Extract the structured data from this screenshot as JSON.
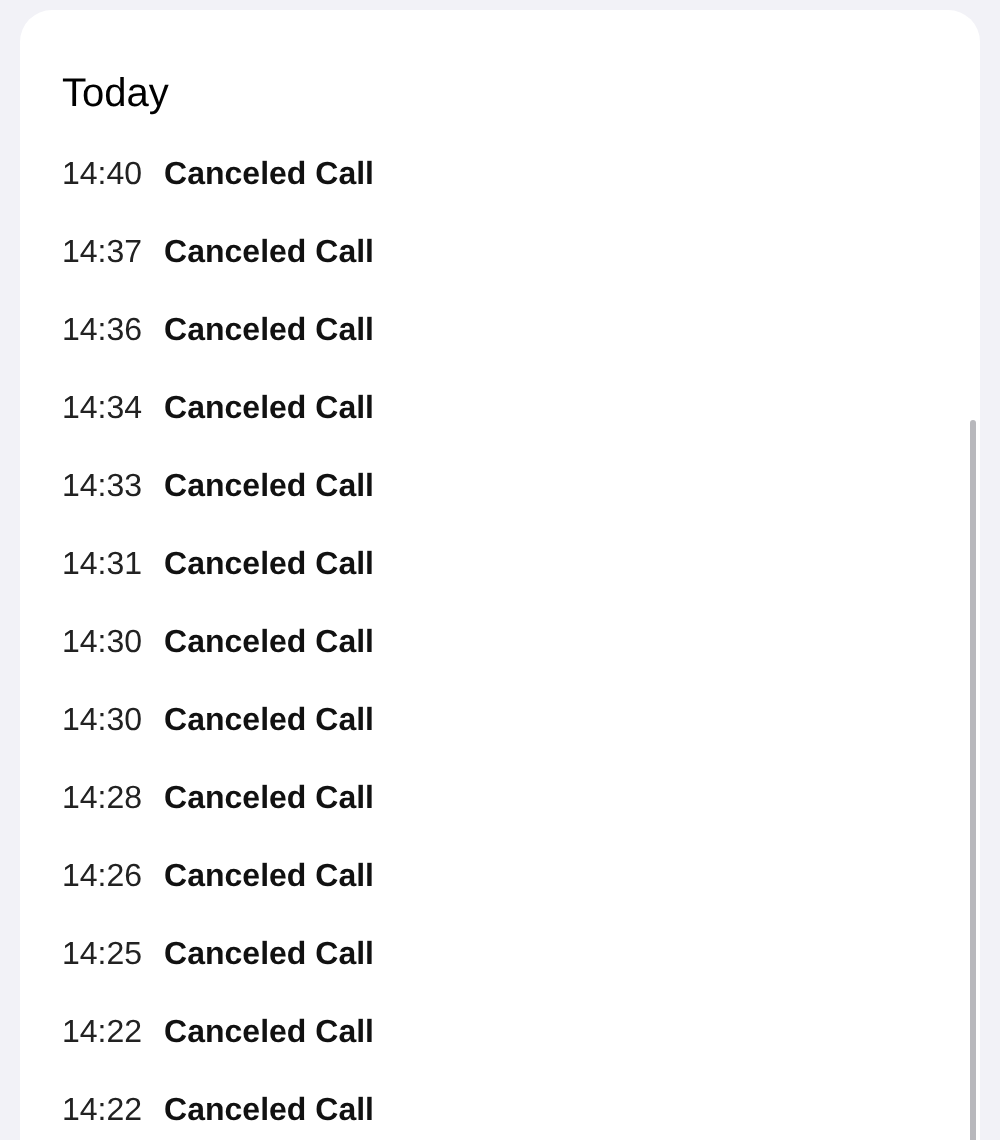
{
  "section": {
    "title": "Today"
  },
  "calls": [
    {
      "time": "14:40",
      "label": "Canceled Call"
    },
    {
      "time": "14:37",
      "label": "Canceled Call"
    },
    {
      "time": "14:36",
      "label": "Canceled Call"
    },
    {
      "time": "14:34",
      "label": "Canceled Call"
    },
    {
      "time": "14:33",
      "label": "Canceled Call"
    },
    {
      "time": "14:31",
      "label": "Canceled Call"
    },
    {
      "time": "14:30",
      "label": "Canceled Call"
    },
    {
      "time": "14:30",
      "label": "Canceled Call"
    },
    {
      "time": "14:28",
      "label": "Canceled Call"
    },
    {
      "time": "14:26",
      "label": "Canceled Call"
    },
    {
      "time": "14:25",
      "label": "Canceled Call"
    },
    {
      "time": "14:22",
      "label": "Canceled Call"
    },
    {
      "time": "14:22",
      "label": "Canceled Call"
    }
  ]
}
